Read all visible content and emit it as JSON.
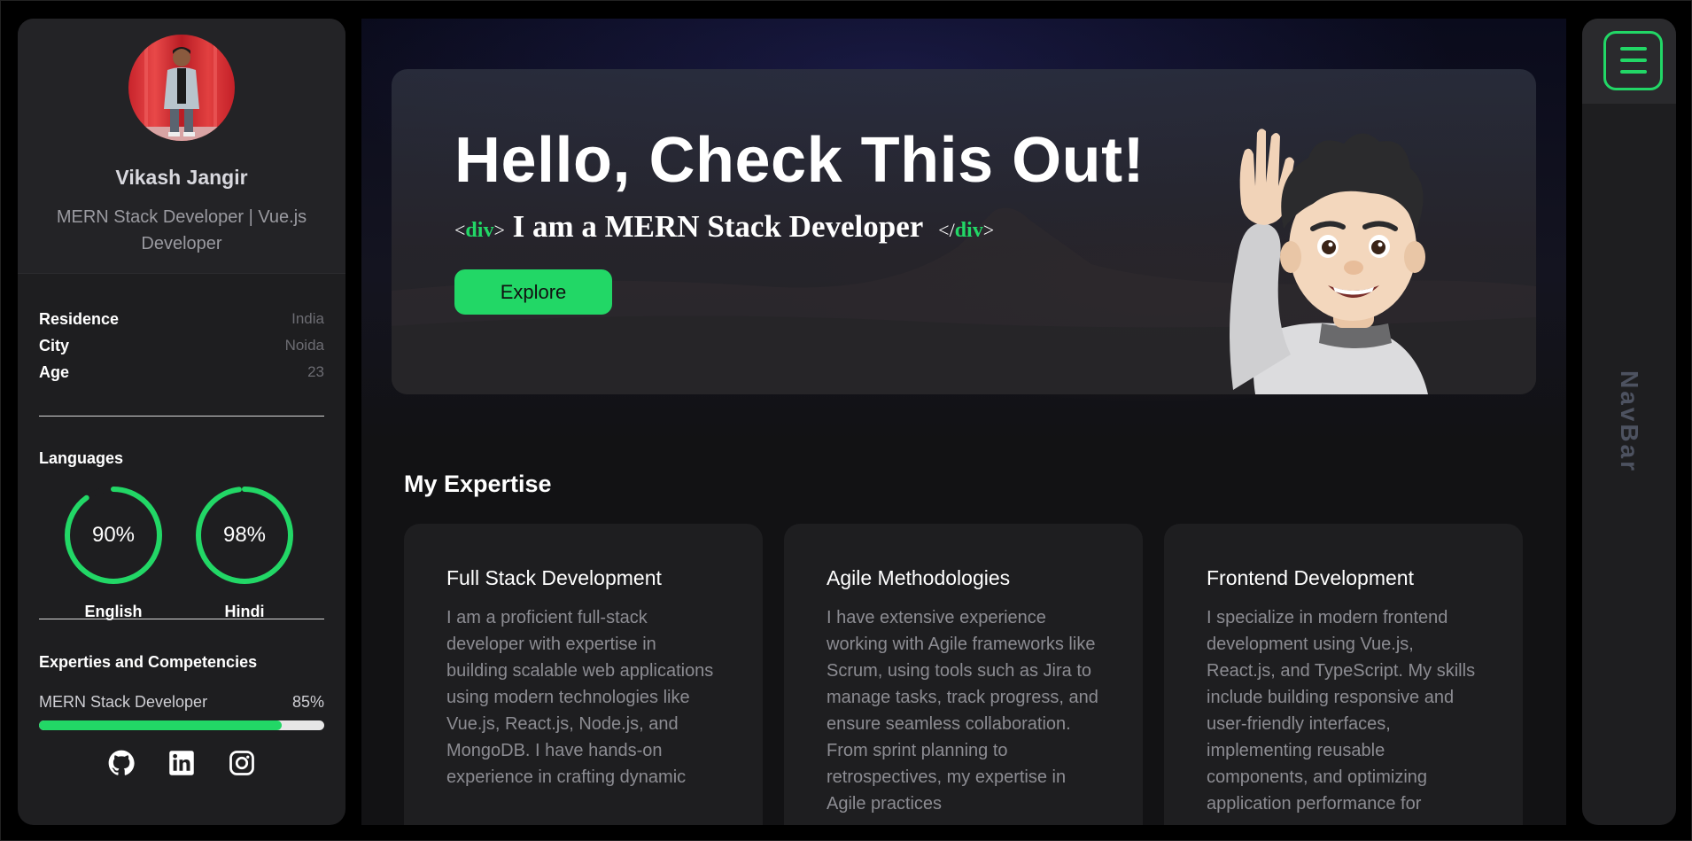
{
  "profile": {
    "name": "Vikash Jangir",
    "role": "MERN Stack Developer | Vue.js Developer"
  },
  "info": [
    {
      "label": "Residence",
      "value": "India"
    },
    {
      "label": "City",
      "value": "Noida"
    },
    {
      "label": "Age",
      "value": "23"
    }
  ],
  "languages": {
    "title": "Languages",
    "items": [
      {
        "name": "English",
        "percent_label": "90%",
        "percent": 90
      },
      {
        "name": "Hindi",
        "percent_label": "98%",
        "percent": 98
      }
    ]
  },
  "skills": {
    "title": "Experties and Competencies",
    "items": [
      {
        "name": "MERN Stack Developer",
        "percent_label": "85%",
        "percent": 85
      }
    ]
  },
  "socials": [
    "github-icon",
    "linkedin-icon",
    "instagram-icon"
  ],
  "hero": {
    "title": "Hello, Check This Out!",
    "tag_open_lt": "<",
    "tag_name": "div",
    "tag_open_gt": ">",
    "subtitle": " I am a MERN Stack Developer ",
    "tag_close_lt": "</",
    "tag_close_gt": ">",
    "button": "Explore"
  },
  "expertise": {
    "title": "My Expertise",
    "cards": [
      {
        "title": "Full Stack Development",
        "text": "I am a proficient full-stack developer with expertise in building scalable web applications using modern technologies like Vue.js, React.js, Node.js, and MongoDB. I have hands-on experience in crafting dynamic"
      },
      {
        "title": "Agile Methodologies",
        "text": "I have extensive experience working with Agile frameworks like Scrum, using tools such as Jira to manage tasks, track progress, and ensure seamless collaboration. From sprint planning to retrospectives, my expertise in Agile practices"
      },
      {
        "title": "Frontend Development",
        "text": "I specialize in modern frontend development using Vue.js, React.js, and TypeScript. My skills include building responsive and user-friendly interfaces, implementing reusable components, and optimizing application performance for"
      }
    ]
  },
  "nav": {
    "label": "NavBar"
  },
  "colors": {
    "accent": "#22d766",
    "panel": "#1e1e20",
    "background": "#000000"
  }
}
